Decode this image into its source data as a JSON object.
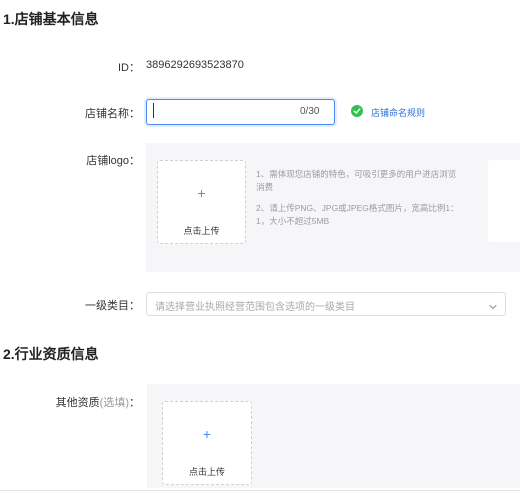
{
  "section1": {
    "title": "1.店铺基本信息"
  },
  "id_row": {
    "label": "ID：",
    "value": "3896292693523870"
  },
  "shop_name": {
    "label": "店铺名称：",
    "value": "",
    "counter": "0/30",
    "rules_link": "店铺命名规则"
  },
  "logo": {
    "label": "店铺logo：",
    "upload_plus": "+",
    "upload_label": "点击上传",
    "hints": [
      "1、需体现您店铺的特色，可吸引更多的用户进店浏览消费",
      "2、请上传PNG、JPG或JPEG格式图片，宽高比例1：1，大小不超过5MB"
    ]
  },
  "category": {
    "label": "一级类目：",
    "placeholder": "请选择营业执照经营范围包含选项的一级类目"
  },
  "section2": {
    "title": "2.行业资质信息"
  },
  "other": {
    "label": "其他资质",
    "optional": "(选填)",
    "colon": "：",
    "upload_plus": "+",
    "upload_label": "点击上传"
  },
  "colors": {
    "accent": "#4a8af4",
    "success": "#2fc24f",
    "link": "#2f6fd9"
  },
  "icons": {
    "check": "check-circle-icon",
    "chevron": "chevron-down-icon"
  }
}
